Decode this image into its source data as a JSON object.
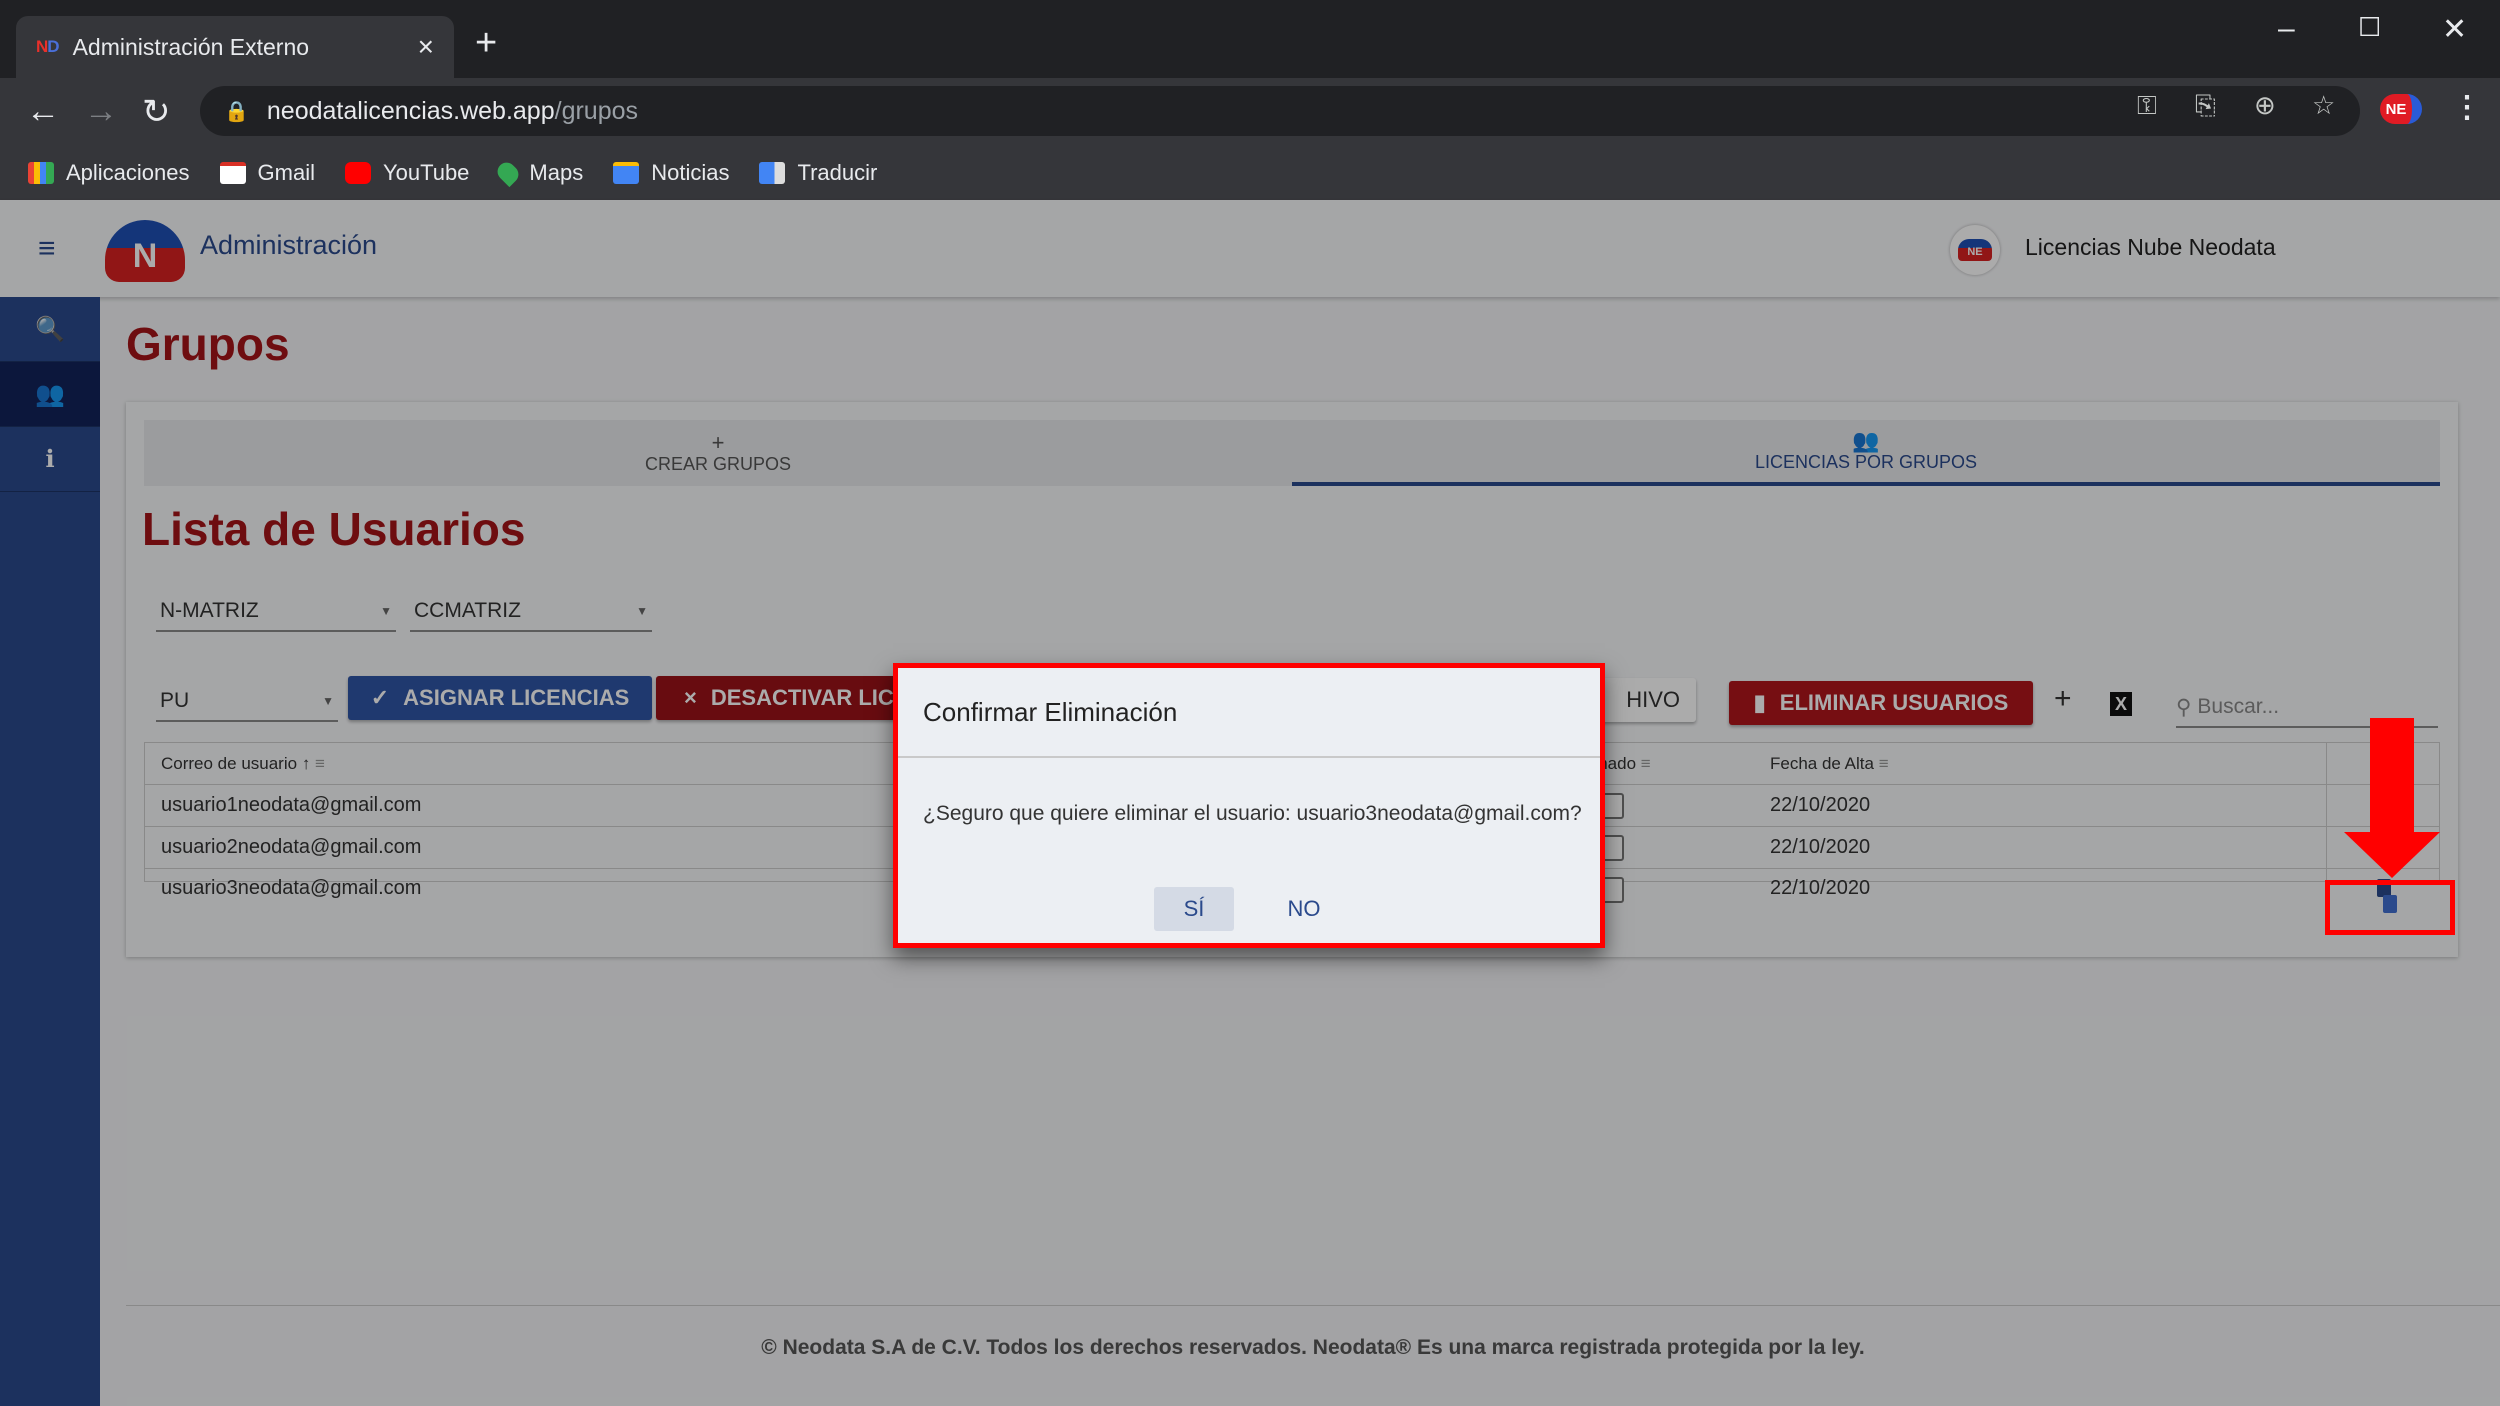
{
  "browser": {
    "tab_title": "Administración Externo",
    "tab_favicon": "ND",
    "new_tab": "+",
    "close_tab": "×",
    "window_controls": {
      "minimize": "–",
      "maximize": "☐",
      "close": "✕"
    },
    "url_host": "neodatalicencias.web.app",
    "url_path": "/grupos",
    "bookmarks": [
      {
        "label": "Aplicaciones",
        "icon": "apps-grid-icon",
        "color": "#ea4335"
      },
      {
        "label": "Gmail",
        "icon": "gmail-icon",
        "color": "#d93025"
      },
      {
        "label": "YouTube",
        "icon": "youtube-icon",
        "color": "#ff0000"
      },
      {
        "label": "Maps",
        "icon": "maps-pin-icon",
        "color": "#34a853"
      },
      {
        "label": "Noticias",
        "icon": "news-icon",
        "color": "#4285f4"
      },
      {
        "label": "Traducir",
        "icon": "translate-icon",
        "color": "#4285f4"
      }
    ],
    "extension_badge": "NE"
  },
  "app": {
    "title": "Administración",
    "logo_text": "N",
    "user_label": "Licencias Nube Neodata",
    "brand_blue": "#2b4a8c",
    "brand_red": "#a51419"
  },
  "sidebar": {
    "items": [
      {
        "name": "search",
        "icon": "🔍"
      },
      {
        "name": "groups",
        "icon": "👥",
        "active": true
      },
      {
        "name": "info",
        "icon": "ℹ"
      }
    ]
  },
  "page": {
    "title": "Grupos",
    "tabs": [
      {
        "label": "CREAR GRUPOS",
        "icon": "+"
      },
      {
        "label": "LICENCIAS POR GRUPOS",
        "icon": "👥",
        "active": true
      }
    ],
    "list_title": "Lista de Usuarios",
    "filters": {
      "company": "N-MATRIZ",
      "center": "CCMATRIZ",
      "product": "PU"
    },
    "buttons": {
      "assign": "ASIGNAR LICENCIAS",
      "assign_icon": "✓",
      "deactivate": "DESACTIVAR LIC",
      "deactivate_icon": "×",
      "archive_partial": "HIVO",
      "delete_users": "ELIMINAR USUARIOS",
      "add": "+",
      "excel": "X"
    },
    "search_placeholder": "Buscar...",
    "table": {
      "headers": {
        "email": "Correo de usuario",
        "sort_icon": "↑",
        "filter_icon": "≡",
        "assigned": "ignado",
        "date": "Fecha de Alta"
      },
      "rows": [
        {
          "email": "usuario1neodata@gmail.com",
          "date": "22/10/2020",
          "assigned": false
        },
        {
          "email": "usuario2neodata@gmail.com",
          "date": "22/10/2020",
          "assigned": false
        },
        {
          "email": "usuario3neodata@gmail.com",
          "date": "22/10/2020",
          "assigned": false
        }
      ]
    },
    "footer": "© Neodata S.A de C.V. Todos los derechos reservados. Neodata® Es una marca registrada protegida por la ley."
  },
  "dialog": {
    "title": "Confirmar Eliminación",
    "message": "¿Seguro que quiere eliminar el usuario: usuario3neodata@gmail.com?",
    "confirm": "SÍ",
    "cancel": "NO"
  }
}
